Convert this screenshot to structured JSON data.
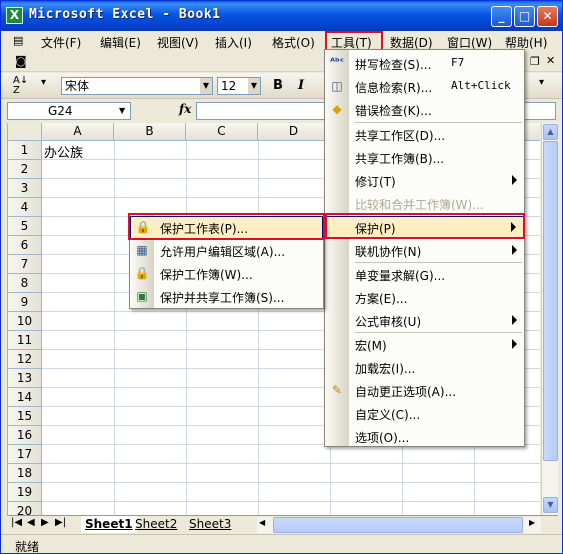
{
  "window": {
    "title": "Microsoft Excel - Book1",
    "app_icon": "excel-icon",
    "controls": [
      "minimize",
      "maximize",
      "close"
    ]
  },
  "menubar": {
    "items": [
      {
        "label": "文件(F)"
      },
      {
        "label": "编辑(E)"
      },
      {
        "label": "视图(V)"
      },
      {
        "label": "插入(I)"
      },
      {
        "label": "格式(O)"
      },
      {
        "label": "工具(T)"
      },
      {
        "label": "数据(D)"
      },
      {
        "label": "窗口(W)"
      },
      {
        "label": "帮助(H)"
      }
    ],
    "active": "工具(T)"
  },
  "format_toolbar": {
    "font_name": "宋体",
    "font_size": "12",
    "bold": "B",
    "italic": "I"
  },
  "formula_bar": {
    "name_box": "G24",
    "fx": "fx",
    "formula": ""
  },
  "grid": {
    "columns": [
      "A",
      "B",
      "C",
      "D"
    ],
    "rows": [
      "1",
      "2",
      "3",
      "4",
      "5",
      "6",
      "7",
      "8",
      "9",
      "10",
      "11",
      "12",
      "13",
      "14",
      "15",
      "16",
      "17",
      "18",
      "19",
      "20"
    ],
    "cells": {
      "A1": "办公族"
    }
  },
  "sheet_tabs": [
    "Sheet1",
    "Sheet2",
    "Sheet3"
  ],
  "status": "就绪",
  "tools_menu": {
    "items": [
      {
        "label": "拼写检查(S)...",
        "shortcut": "F7",
        "icon": "spellcheck-icon"
      },
      {
        "label": "信息检索(R)...",
        "shortcut": "Alt+Click",
        "icon": "research-icon"
      },
      {
        "label": "错误检查(K)...",
        "icon": "error-check-icon"
      },
      {
        "label": "共享工作区(D)..."
      },
      {
        "label": "共享工作簿(B)..."
      },
      {
        "label": "修订(T)",
        "submenu": true
      },
      {
        "label": "比较和合并工作簿(W)...",
        "disabled": true
      },
      {
        "label": "保护(P)",
        "submenu": true,
        "highlighted": true
      },
      {
        "label": "联机协作(N)",
        "submenu": true
      },
      {
        "label": "单变量求解(G)..."
      },
      {
        "label": "方案(E)..."
      },
      {
        "label": "公式审核(U)",
        "submenu": true
      },
      {
        "label": "宏(M)",
        "submenu": true
      },
      {
        "label": "加载宏(I)..."
      },
      {
        "label": "自动更正选项(A)...",
        "icon": "autocorrect-icon"
      },
      {
        "label": "自定义(C)..."
      },
      {
        "label": "选项(O)..."
      }
    ]
  },
  "protect_submenu": {
    "items": [
      {
        "label": "保护工作表(P)...",
        "highlighted": true,
        "icon": "protect-sheet-icon"
      },
      {
        "label": "允许用户编辑区域(A)...",
        "icon": "allow-edit-icon"
      },
      {
        "label": "保护工作簿(W)...",
        "icon": "protect-workbook-icon"
      },
      {
        "label": "保护并共享工作簿(S)...",
        "icon": "protect-share-icon"
      }
    ]
  },
  "colors": {
    "title_bar": "#0655e5",
    "highlight": "#ffeec2",
    "annotation_red": "#d9102a"
  }
}
